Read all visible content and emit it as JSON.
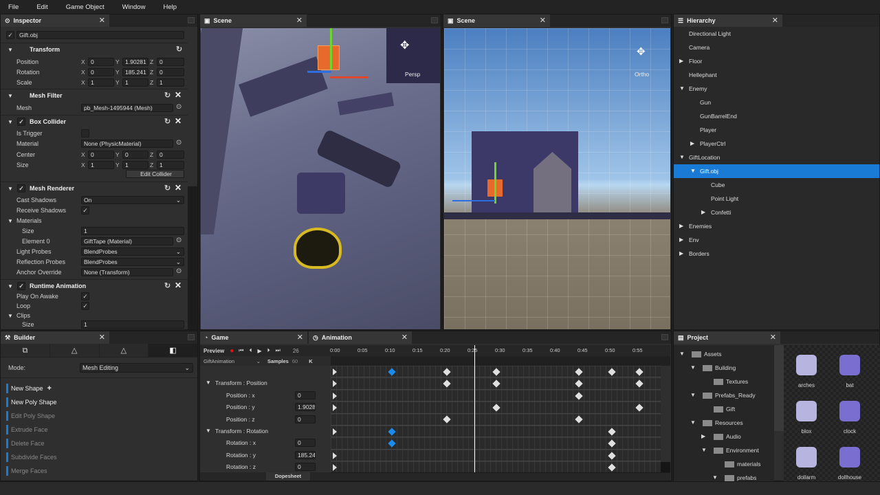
{
  "menu": [
    "File",
    "Edit",
    "Game Object",
    "Window",
    "Help"
  ],
  "inspector": {
    "title": "Inspector",
    "object_name": "Gift.obj",
    "transform": {
      "title": "Transform",
      "rows": [
        {
          "label": "Position",
          "x": "0",
          "y": "1.90281",
          "z": "0"
        },
        {
          "label": "Rotation",
          "x": "0",
          "y": "185.241",
          "z": "0"
        },
        {
          "label": "Scale",
          "x": "1",
          "y": "1",
          "z": "1"
        }
      ]
    },
    "mesh_filter": {
      "title": "Mesh Filter",
      "mesh_label": "Mesh",
      "mesh_value": "pb_Mesh-1495944 (Mesh)"
    },
    "box_collider": {
      "title": "Box Collider",
      "is_trigger": "Is Trigger",
      "material_label": "Material",
      "material_value": "None (PhysicMaterial)",
      "center": {
        "label": "Center",
        "x": "0",
        "y": "0",
        "z": "0"
      },
      "size": {
        "label": "Size",
        "x": "1",
        "y": "1",
        "z": "1"
      },
      "edit_button": "Edit Collider"
    },
    "mesh_renderer": {
      "title": "Mesh Renderer",
      "cast_shadows_label": "Cast Shadows",
      "cast_shadows_value": "On",
      "receive_shadows_label": "Receive Shadows",
      "materials_label": "Materials",
      "size_label": "Size",
      "size_value": "1",
      "element0_label": "Element 0",
      "element0_value": "GiftTape (Material)",
      "light_probes_label": "Light Probes",
      "light_probes_value": "BlendProbes",
      "reflection_probes_label": "Reflection Probes",
      "reflection_probes_value": "BlendProbes",
      "anchor_label": "Anchor Override",
      "anchor_value": "None (Transform)"
    },
    "runtime_animation": {
      "title": "Runtime Animation",
      "play_on_awake": "Play On Awake",
      "loop": "Loop",
      "clips": "Clips",
      "clips_size": "Size",
      "clips_size_value": "1"
    },
    "axis_labels": {
      "x": "X",
      "y": "Y",
      "z": "Z"
    }
  },
  "scene_left": {
    "title": "Scene",
    "projection": "Persp"
  },
  "scene_right": {
    "title": "Scene",
    "projection": "Ortho"
  },
  "hierarchy": {
    "title": "Hierarchy",
    "selected_color": "#1a7bd6",
    "items": [
      {
        "label": "Directional Light",
        "depth": 0,
        "arrow": ""
      },
      {
        "label": "Camera",
        "depth": 0,
        "arrow": ""
      },
      {
        "label": "Floor",
        "depth": 0,
        "arrow": "▶"
      },
      {
        "label": "Hellephant",
        "depth": 0,
        "arrow": ""
      },
      {
        "label": "Enemy",
        "depth": 0,
        "arrow": "▼"
      },
      {
        "label": "Gun",
        "depth": 1,
        "arrow": ""
      },
      {
        "label": "GunBarrelEnd",
        "depth": 1,
        "arrow": ""
      },
      {
        "label": "Player",
        "depth": 1,
        "arrow": ""
      },
      {
        "label": "PlayerCtrl",
        "depth": 1,
        "arrow": "▶"
      },
      {
        "label": "GiftLocation",
        "depth": 0,
        "arrow": "▼"
      },
      {
        "label": "Gift.obj",
        "depth": 1,
        "arrow": "▼",
        "selected": true
      },
      {
        "label": "Cube",
        "depth": 2,
        "arrow": ""
      },
      {
        "label": "Point Light",
        "depth": 2,
        "arrow": ""
      },
      {
        "label": "Confetti",
        "depth": 2,
        "arrow": "▶"
      },
      {
        "label": "Enemies",
        "depth": 0,
        "arrow": "▶"
      },
      {
        "label": "Env",
        "depth": 0,
        "arrow": "▶"
      },
      {
        "label": "Borders",
        "depth": 0,
        "arrow": "▶"
      }
    ]
  },
  "builder": {
    "title": "Builder",
    "mode_label": "Mode:",
    "mode_value": "Mesh Editing",
    "tools": [
      "New Shape",
      "New Poly Shape",
      "Edit Poly Shape",
      "Extrude Face",
      "Delete Face",
      "Subdivide Faces",
      "Merge Faces"
    ],
    "enabled_count": 2
  },
  "game": {
    "title": "Game"
  },
  "animation": {
    "title": "Animation",
    "preview": "Preview",
    "frame": "26",
    "clip": "GiftAnimation",
    "samples_label": "Samples",
    "samples_value": "60",
    "key_button": "K",
    "dopesheet": "Dopesheet",
    "time_labels": [
      "0:00",
      "0:05",
      "0:10",
      "0:15",
      "0:20",
      "0:25",
      "0:30",
      "0:35",
      "0:40",
      "0:45",
      "0:50",
      "0:55"
    ],
    "playhead": 25,
    "properties": [
      {
        "label": "",
        "value": null,
        "group": false
      },
      {
        "label": "Transform : Position",
        "group": true
      },
      {
        "label": "Position : x",
        "value": "0"
      },
      {
        "label": "Position : y",
        "value": "1.9028"
      },
      {
        "label": "Position : z",
        "value": "0"
      },
      {
        "label": "Transform : Rotation",
        "group": true
      },
      {
        "label": "Rotation : x",
        "value": "0"
      },
      {
        "label": "Rotation : y",
        "value": "185.24"
      },
      {
        "label": "Rotation : z",
        "value": "0"
      }
    ],
    "tracks": [
      {
        "start": true,
        "keys": [
          10,
          20,
          29,
          44,
          50,
          55
        ],
        "selected": [
          10
        ]
      },
      {
        "start": true,
        "keys": [
          20,
          29,
          44,
          55
        ],
        "selected": []
      },
      {
        "start": true,
        "keys": [
          44
        ],
        "selected": []
      },
      {
        "start": true,
        "keys": [
          29,
          55
        ],
        "selected": []
      },
      {
        "start": false,
        "keys": [
          20,
          44
        ],
        "selected": []
      },
      {
        "start": true,
        "keys": [
          10,
          50
        ],
        "selected": [
          10
        ]
      },
      {
        "start": false,
        "keys": [
          10,
          50
        ],
        "selected": [
          10
        ]
      },
      {
        "start": true,
        "keys": [
          50
        ],
        "selected": []
      },
      {
        "start": true,
        "keys": [
          50
        ],
        "selected": []
      }
    ],
    "selected_key_color": "#1a8cf0"
  },
  "project": {
    "title": "Project",
    "tree": [
      {
        "label": "Assets",
        "depth": 0,
        "arrow": "▼"
      },
      {
        "label": "Building",
        "depth": 1,
        "arrow": "▼"
      },
      {
        "label": "Textures",
        "depth": 2,
        "arrow": ""
      },
      {
        "label": "Prefabs_Ready",
        "depth": 1,
        "arrow": "▼"
      },
      {
        "label": "Gift",
        "depth": 2,
        "arrow": ""
      },
      {
        "label": "Resources",
        "depth": 1,
        "arrow": "▼"
      },
      {
        "label": "Audio",
        "depth": 2,
        "arrow": "▶"
      },
      {
        "label": "Environment",
        "depth": 2,
        "arrow": "▼"
      },
      {
        "label": "materials",
        "depth": 3,
        "arrow": ""
      },
      {
        "label": "prefabs",
        "depth": 3,
        "arrow": "▼"
      }
    ],
    "assets": [
      "arches",
      "bat",
      "blox",
      "clock",
      "dollarm",
      "dollhouse"
    ]
  }
}
